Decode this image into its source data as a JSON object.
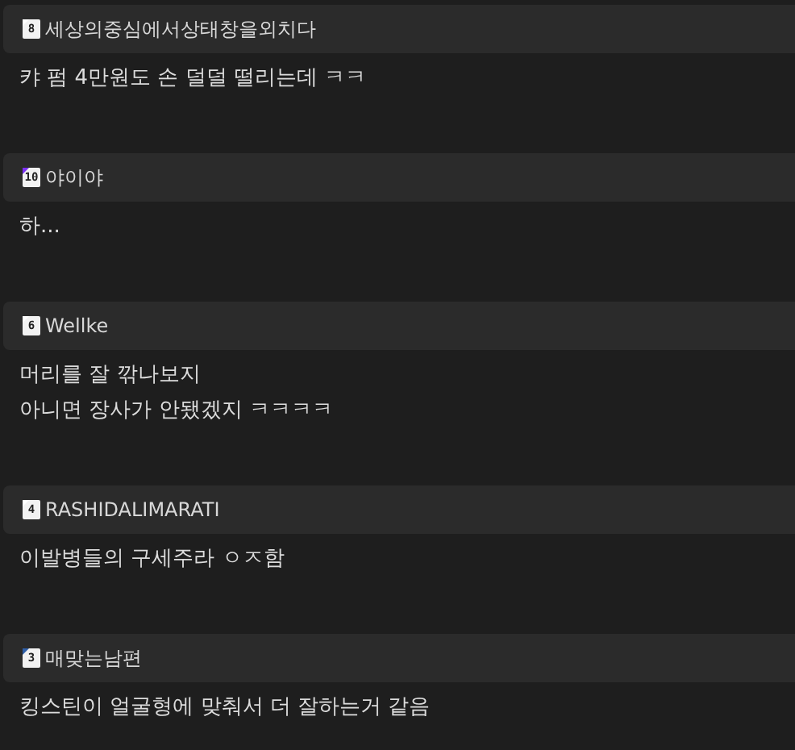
{
  "comments": [
    {
      "level": "8",
      "color": "#ffffff",
      "author": "세상의중심에서상태창을외치다",
      "lines": [
        "캬 펌 4만원도 손 덜덜 떨리는데 ㅋㅋ"
      ]
    },
    {
      "level": "10",
      "color": "#7b2ff7",
      "author": "야이야",
      "lines": [
        "하..."
      ]
    },
    {
      "level": "6",
      "color": "#ffffff",
      "author": "Wellke",
      "lines": [
        "머리를 잘 깎나보지",
        "아니면 장사가 안됐겠지 ㅋㅋㅋㅋ"
      ]
    },
    {
      "level": "4",
      "color": "#ffffff",
      "author": "RASHIDALIMARATI",
      "lines": [
        "이발병들의 구세주라 ㅇㅈ함"
      ]
    },
    {
      "level": "3",
      "color": "#2f5fa8",
      "author": "매맞는남편",
      "lines": [
        "킹스틴이 얼굴형에 맞춰서 더 잘하는거 같음"
      ]
    }
  ]
}
